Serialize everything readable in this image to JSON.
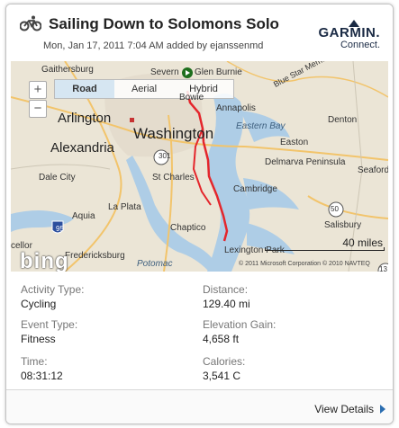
{
  "header": {
    "title": "Sailing Down to Solomons Solo",
    "subtitle": "Mon, Jan 17, 2011 7:04 AM added by ejanssenmd",
    "activity_icon": "bicycle-icon",
    "brand_name": "GARMIN.",
    "brand_sub": "Connect."
  },
  "map": {
    "map_types": [
      "Road",
      "Aerial",
      "Hybrid"
    ],
    "selected_map_type": "Road",
    "zoom_in": "+",
    "zoom_out": "−",
    "scale_label": "40 miles",
    "logo": "bing",
    "copyright": "© 2011 Microsoft Corporation   © 2010 NAVTEQ",
    "route_color": "#e4262c",
    "labels": {
      "gaithersburg": "Gaithersburg",
      "severn": "Severn",
      "glen_burnie": "Glen Burnie",
      "bowie": "Bowie",
      "annapolis": "Annapolis",
      "arlington": "Arlington",
      "alexandria": "Alexandria",
      "washington": "Washington",
      "dale_city": "Dale City",
      "st_charles": "St Charles",
      "la_plata": "La Plata",
      "aquia": "Aquia",
      "chaptico": "Chaptico",
      "lexington_park": "Lexington Park",
      "potomac": "Potomac",
      "fredericksburg": "Fredericksburg",
      "cellor": "cellor",
      "easton": "Easton",
      "eastern_bay": "Eastern Bay",
      "delmarva": "Delmarva Peninsula",
      "cambridge": "Cambridge",
      "denton": "Denton",
      "seaford": "Seaford",
      "salisbury": "Salisbury",
      "blue_star": "Blue Star Memorial",
      "route_301": "301",
      "route_95": "95",
      "route_50": "50",
      "route_13": "13"
    }
  },
  "stats": {
    "activity_type_label": "Activity Type:",
    "activity_type_value": "Cycling",
    "distance_label": "Distance:",
    "distance_value": "129.40 mi",
    "event_type_label": "Event Type:",
    "event_type_value": "Fitness",
    "elevation_label": "Elevation Gain:",
    "elevation_value": "4,658 ft",
    "time_label": "Time:",
    "time_value": "08:31:12",
    "calories_label": "Calories:",
    "calories_value": "3,541 C"
  },
  "footer": {
    "view_details": "View Details"
  }
}
